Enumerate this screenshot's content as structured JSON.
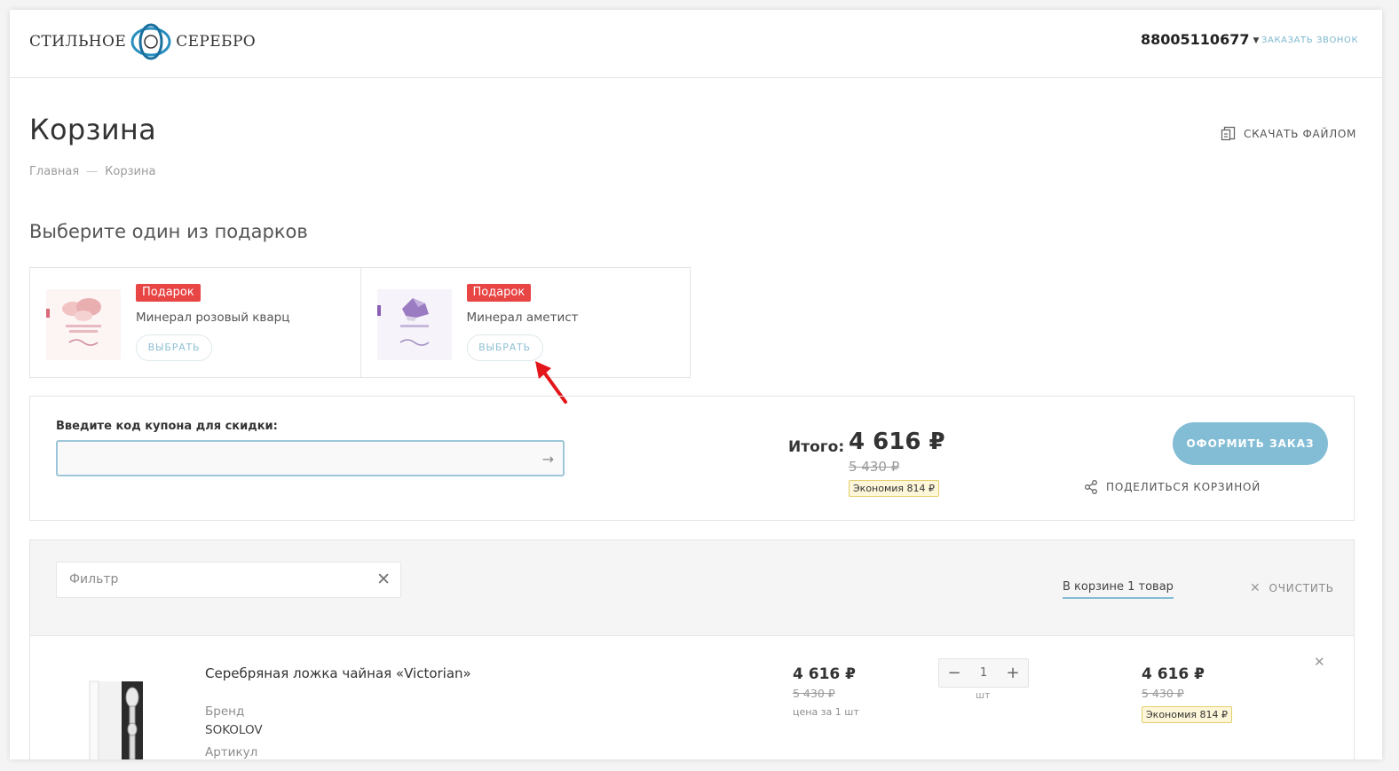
{
  "header": {
    "logo_left": "СТИЛЬНОЕ",
    "logo_right": "СЕРЕБРО",
    "phone": "88005110677",
    "callback_label": "ЗАКАЗАТЬ ЗВОНОК"
  },
  "page": {
    "title": "Корзина",
    "download_label": "СКАЧАТЬ ФАЙЛОМ",
    "breadcrumb": [
      "Главная",
      "Корзина"
    ]
  },
  "gifts": {
    "title": "Выберите один из подарков",
    "items": [
      {
        "badge": "Подарок",
        "name": "Минерал розовый кварц",
        "button": "ВЫБРАТЬ"
      },
      {
        "badge": "Подарок",
        "name": "Минерал аметист",
        "button": "ВЫБРАТЬ"
      }
    ]
  },
  "order": {
    "coupon_label": "Введите код купона для скидки:",
    "coupon_value": "",
    "total_label": "Итого:",
    "total": "4 616 ₽",
    "total_old": "5 430 ₽",
    "savings": "Экономия 814 ₽",
    "checkout_label": "ОФОРМИТЬ ЗАКАЗ",
    "share_label": "ПОДЕЛИТЬСЯ КОРЗИНОЙ"
  },
  "cart": {
    "filter_placeholder": "Фильтр",
    "count_label": "В корзине 1 товар",
    "clear_label": "ОЧИСТИТЬ",
    "items": [
      {
        "name": "Серебряная ложка чайная «Victorian»",
        "brand_label": "Бренд",
        "brand": "SOKOLOV",
        "sku_label": "Артикул",
        "price": "4 616 ₽",
        "price_old": "5 430 ₽",
        "price_note": "цена за 1 шт",
        "quantity": "1",
        "unit": "шт",
        "sum": "4 616 ₽",
        "sum_old": "5 430 ₽",
        "savings": "Экономия 814 ₽"
      }
    ]
  },
  "colors": {
    "accent": "#83bdd5",
    "badge_red": "#e84545",
    "savings_bg": "#fdf6d8"
  }
}
